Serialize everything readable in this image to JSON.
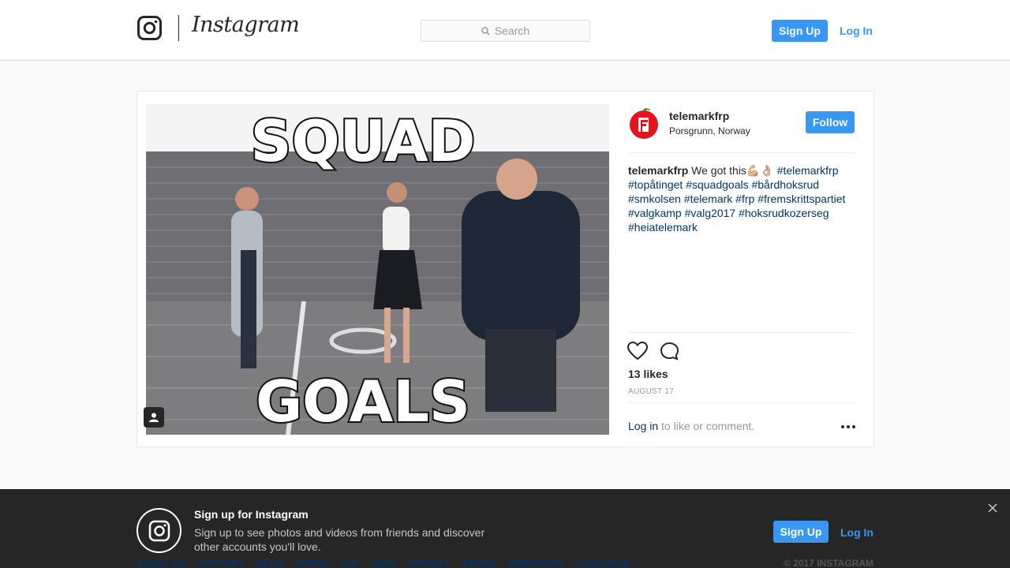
{
  "header": {
    "wordmark": "Instagram",
    "search_placeholder": "Search",
    "signup_label": "Sign Up",
    "login_label": "Log In",
    "logo_icon": "instagram-camera-icon"
  },
  "post": {
    "username": "telemarkfrp",
    "location": "Porsgrunn, Norway",
    "follow_label": "Follow",
    "caption_user": "telemarkfrp",
    "caption_text": " We got this💪🏼👌🏼 ",
    "hashtags": [
      "#telemarkfrp",
      "#topåtinget",
      "#squadgoals",
      "#bårdhoksrud",
      "#smkolsen",
      "#telemark",
      "#frp",
      "#fremskrittspartiet",
      "#valgkamp",
      "#valg2017",
      "#hoksrudkozerseg",
      "#heiatelemark"
    ],
    "photo_top_text": "SQUAD",
    "photo_bottom_text": "GOALS",
    "likes": "13 likes",
    "date": "AUGUST 17",
    "login_link": "Log in",
    "login_rest": " to like or comment.",
    "colors": {
      "accent": "#3897f0",
      "link": "#003569",
      "avatar_red": "#e3141b"
    }
  },
  "signup_banner": {
    "title": "Sign up for Instagram",
    "description": "Sign up to see photos and videos from friends and discover other accounts you'll love.",
    "signup_label": "Sign Up",
    "login_label": "Log In"
  },
  "footer": {
    "links": [
      "ABOUT US",
      "SUPPORT",
      "BLOG",
      "PRESS",
      "API",
      "JOBS",
      "PRIVACY",
      "TERMS",
      "DIRECTORY",
      "LANGUAGE"
    ],
    "copyright": "© 2017 INSTAGRAM"
  }
}
